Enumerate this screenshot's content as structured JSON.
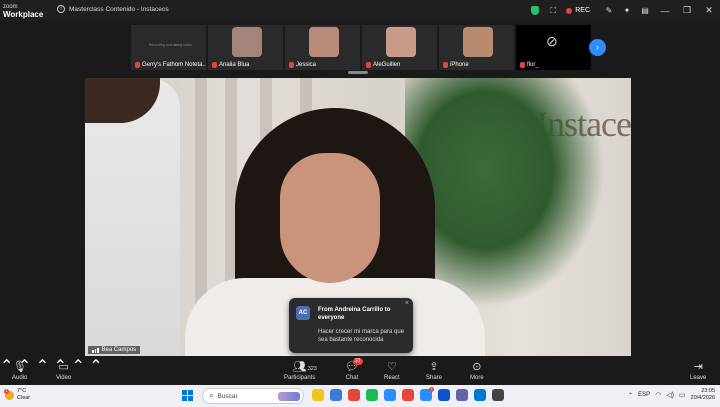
{
  "app": {
    "logo_top": "zoom",
    "logo_bottom": "Workplace",
    "window_title": "Masterclass Contenido - Instaceos",
    "rec_label": "REC"
  },
  "thumbnails": [
    {
      "name": "Gerry's Fathom Noteta...",
      "muted": true,
      "face_color": "#2a2a2a",
      "note": "Recording and taking notes"
    },
    {
      "name": "Analia Blua",
      "muted": true,
      "face_color": "#a2847a"
    },
    {
      "name": "Jessica",
      "muted": true,
      "face_color": "#b98b7a"
    },
    {
      "name": "AleGuillen",
      "muted": true,
      "face_color": "#c99a8a"
    },
    {
      "name": "iPhone",
      "muted": true,
      "face_color": "#b88a70"
    },
    {
      "name": "flor_",
      "muted": true,
      "face_color": "#000000",
      "video_off": true
    }
  ],
  "main_video": {
    "speaker_name": "Bea Campos",
    "backdrop_text": "Instace"
  },
  "chat_toast": {
    "avatar_initials": "AC",
    "from": "From Andreina Carrillo to everyone",
    "message": "Hacer crecer mi marca para que sea bastante reconocida",
    "close": "×"
  },
  "toolbar": {
    "audio": "Audio",
    "video": "Video",
    "participants": "Participants",
    "participants_count": "323",
    "chat": "Chat",
    "chat_badge": "21",
    "react": "React",
    "share": "Share",
    "more": "More",
    "leave": "Leave"
  },
  "taskbar": {
    "temperature": "7°C",
    "weather": "Clear",
    "weather_badge": "1",
    "search_placeholder": "Buscar",
    "language": "ESP",
    "time": "23:05",
    "date": "20/4/2026",
    "app_colors": [
      "#f0c419",
      "#3a7bd5",
      "#e8443b",
      "#1db954",
      "#2d8cff",
      "#e8443b",
      "#2d8cff",
      "#0b53ce",
      "#6264a7",
      "#0078d4",
      "#444444"
    ],
    "app_badges": [
      "",
      "",
      "",
      "",
      "",
      "",
      "1",
      "",
      "",
      "",
      ""
    ]
  },
  "colors": {
    "accent": "#2d8cff",
    "rec": "#e8443b",
    "mute": "#e8443b"
  }
}
